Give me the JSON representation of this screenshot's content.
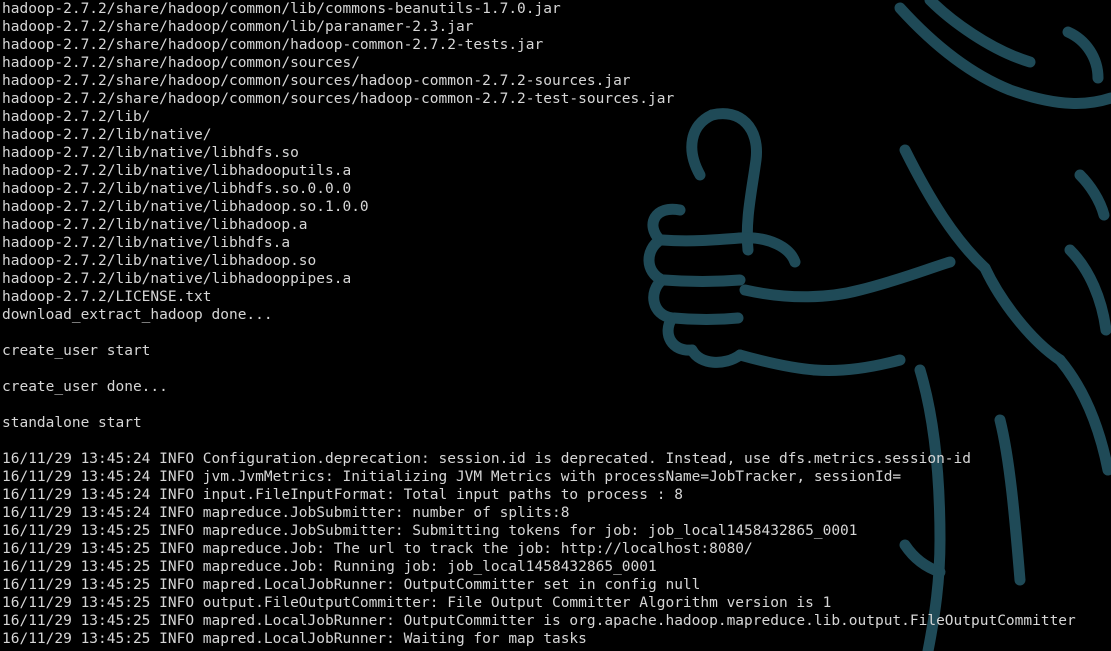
{
  "terminal": {
    "background_color": "#000000",
    "text_color": "#d6d6d6",
    "wallpaper": {
      "icon": "thumbs-up-mascot-icon",
      "line_color": "#1f4a57"
    },
    "lines": [
      "hadoop-2.7.2/share/hadoop/common/lib/commons-beanutils-1.7.0.jar",
      "hadoop-2.7.2/share/hadoop/common/lib/paranamer-2.3.jar",
      "hadoop-2.7.2/share/hadoop/common/hadoop-common-2.7.2-tests.jar",
      "hadoop-2.7.2/share/hadoop/common/sources/",
      "hadoop-2.7.2/share/hadoop/common/sources/hadoop-common-2.7.2-sources.jar",
      "hadoop-2.7.2/share/hadoop/common/sources/hadoop-common-2.7.2-test-sources.jar",
      "hadoop-2.7.2/lib/",
      "hadoop-2.7.2/lib/native/",
      "hadoop-2.7.2/lib/native/libhdfs.so",
      "hadoop-2.7.2/lib/native/libhadooputils.a",
      "hadoop-2.7.2/lib/native/libhdfs.so.0.0.0",
      "hadoop-2.7.2/lib/native/libhadoop.so.1.0.0",
      "hadoop-2.7.2/lib/native/libhadoop.a",
      "hadoop-2.7.2/lib/native/libhdfs.a",
      "hadoop-2.7.2/lib/native/libhadoop.so",
      "hadoop-2.7.2/lib/native/libhadooppipes.a",
      "hadoop-2.7.2/LICENSE.txt",
      "download_extract_hadoop done...",
      "",
      "create_user start",
      "",
      "create_user done...",
      "",
      "standalone start",
      "",
      "16/11/29 13:45:24 INFO Configuration.deprecation: session.id is deprecated. Instead, use dfs.metrics.session-id",
      "16/11/29 13:45:24 INFO jvm.JvmMetrics: Initializing JVM Metrics with processName=JobTracker, sessionId=",
      "16/11/29 13:45:24 INFO input.FileInputFormat: Total input paths to process : 8",
      "16/11/29 13:45:24 INFO mapreduce.JobSubmitter: number of splits:8",
      "16/11/29 13:45:25 INFO mapreduce.JobSubmitter: Submitting tokens for job: job_local1458432865_0001",
      "16/11/29 13:45:25 INFO mapreduce.Job: The url to track the job: http://localhost:8080/",
      "16/11/29 13:45:25 INFO mapreduce.Job: Running job: job_local1458432865_0001",
      "16/11/29 13:45:25 INFO mapred.LocalJobRunner: OutputCommitter set in config null",
      "16/11/29 13:45:25 INFO output.FileOutputCommitter: File Output Committer Algorithm version is 1",
      "16/11/29 13:45:25 INFO mapred.LocalJobRunner: OutputCommitter is org.apache.hadoop.mapreduce.lib.output.FileOutputCommitter",
      "16/11/29 13:45:25 INFO mapred.LocalJobRunner: Waiting for map tasks"
    ]
  }
}
